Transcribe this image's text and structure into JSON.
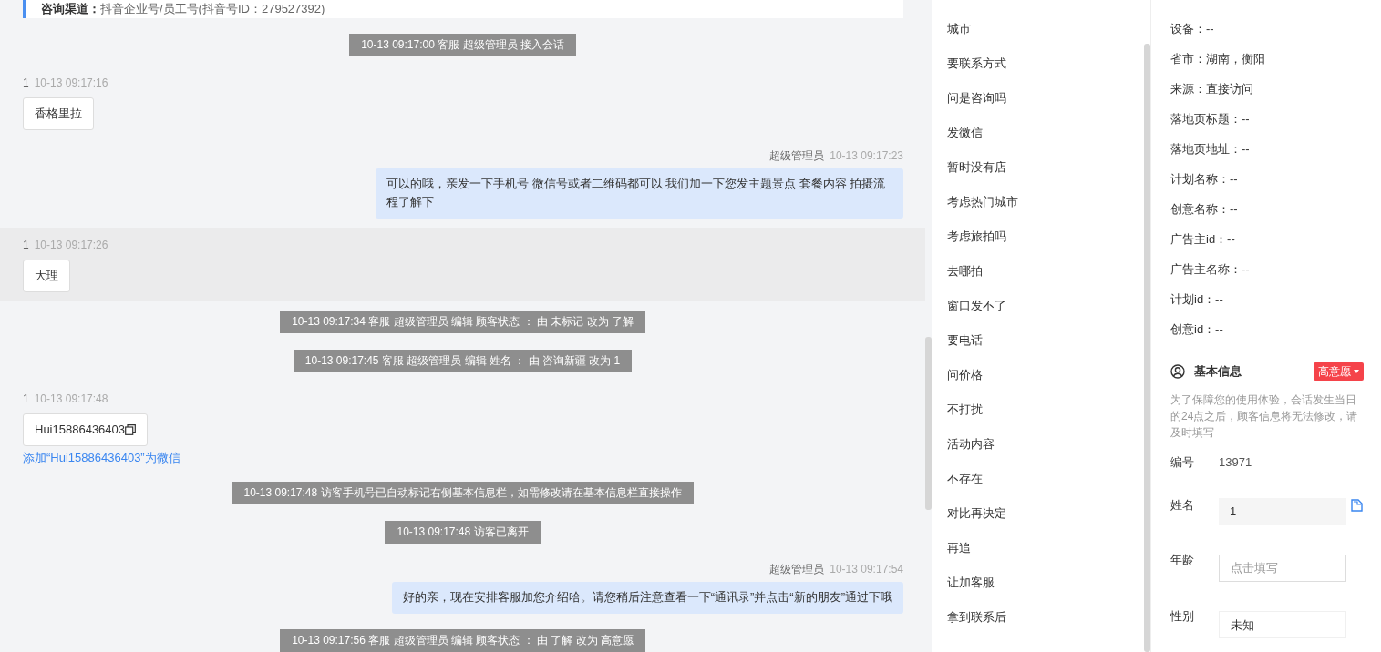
{
  "chat": {
    "channel_card": {
      "label": "咨询渠道：",
      "value": "抖音企业号/员工号(抖音号ID：279527392)"
    },
    "messages": [
      {
        "kind": "system",
        "text": "10-13 09:17:00 客服 超级管理员 接入会话"
      },
      {
        "kind": "visitor",
        "sender": "1",
        "time": "10-13 09:17:16",
        "text": "香格里拉",
        "highlighted": false
      },
      {
        "kind": "agent",
        "sender": "超级管理员",
        "time": "10-13 09:17:23",
        "text": "可以的哦，亲发一下手机号 微信号或者二维码都可以 我们加一下您发主题景点 套餐内容 拍摄流程了解下"
      },
      {
        "kind": "visitor",
        "sender": "1",
        "time": "10-13 09:17:26",
        "text": "大理",
        "highlighted": true
      },
      {
        "kind": "system",
        "text": "10-13 09:17:34 客服 超级管理员 编辑 顾客状态 ： 由 未标记 改为 了解"
      },
      {
        "kind": "system",
        "text": "10-13 09:17:45 客服 超级管理员 编辑 姓名 ： 由 咨询新疆 改为 1"
      },
      {
        "kind": "visitor",
        "sender": "1",
        "time": "10-13 09:17:48",
        "text": "Hui15886436403",
        "highlighted": false,
        "copyable": true,
        "link": "添加“Hui15886436403”为微信"
      },
      {
        "kind": "system",
        "text": "10-13 09:17:48 访客手机号已自动标记右侧基本信息栏，如需修改请在基本信息栏直接操作"
      },
      {
        "kind": "system",
        "text": "10-13 09:17:48 访客已离开"
      },
      {
        "kind": "agent",
        "sender": "超级管理员",
        "time": "10-13 09:17:54",
        "text": "好的亲，现在安排客服加您介绍哈。请您稍后注意查看一下“通讯录”并点击“新的朋友”通过下哦"
      },
      {
        "kind": "system",
        "text": "10-13 09:17:56 客服 超级管理员 编辑 顾客状态 ： 由 了解 改为 高意愿"
      }
    ]
  },
  "quick_replies": [
    "城市",
    "要联系方式",
    "问是咨询吗",
    "发微信",
    "暂时没有店",
    "考虑热门城市",
    "考虑旅拍吗",
    "去哪拍",
    "窗口发不了",
    "要电话",
    "问价格",
    "不打扰",
    "活动内容",
    "不存在",
    "对比再决定",
    "再追",
    "让加客服",
    "拿到联系后"
  ],
  "details": [
    "设备：--",
    "省市：湖南，衡阳",
    "来源：直接访问",
    "落地页标题：--",
    "落地页地址：--",
    "计划名称：--",
    "创意名称：--",
    "广告主id：--",
    "广告主名称：--",
    "计划id：--",
    "创意id：--"
  ],
  "basic_info": {
    "title": "基本信息",
    "status": "高意愿",
    "notice": "为了保障您的使用体验，会话发生当日的24点之后，顾客信息将无法修改，请及时填写",
    "fields": [
      {
        "kind": "static",
        "label": "编号",
        "value": "13971"
      },
      {
        "kind": "readonly",
        "label": "姓名",
        "value": "1"
      },
      {
        "kind": "input",
        "label": "年龄",
        "placeholder": "点击填写"
      },
      {
        "kind": "select",
        "label": "性别",
        "value": "未知"
      }
    ]
  }
}
